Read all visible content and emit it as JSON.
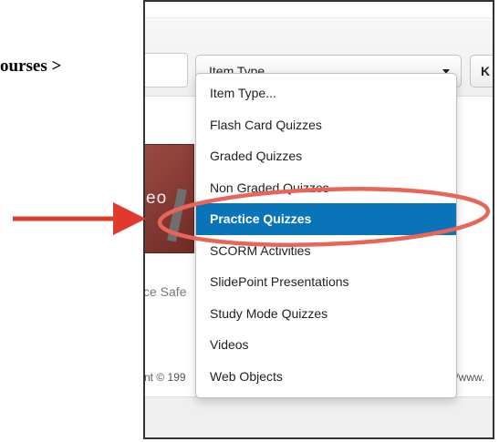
{
  "breadcrumb": {
    "text": "ourses >"
  },
  "toolbar": {
    "item_type_value": "Item Type...",
    "right_button_label": "K"
  },
  "dropdown": {
    "options": [
      {
        "label": "Item Type..."
      },
      {
        "label": "Flash Card Quizzes"
      },
      {
        "label": "Graded Quizzes"
      },
      {
        "label": "Non Graded Quizzes"
      },
      {
        "label": "Practice Quizzes"
      },
      {
        "label": "SCORM Activities"
      },
      {
        "label": "SlidePoint Presentations"
      },
      {
        "label": "Study Mode Quizzes"
      },
      {
        "label": "Videos"
      },
      {
        "label": "Web Objects"
      }
    ],
    "selected": "Practice Quizzes"
  },
  "background": {
    "thumbnail_text": "eo",
    "course_caption": "ce Safe",
    "footer_left": "nt © 199",
    "footer_right": "//www."
  },
  "annotations": {
    "arrow_color": "#e03a2f",
    "ellipse_color": "#e8655a",
    "highlight_color": "#0a74b8"
  }
}
